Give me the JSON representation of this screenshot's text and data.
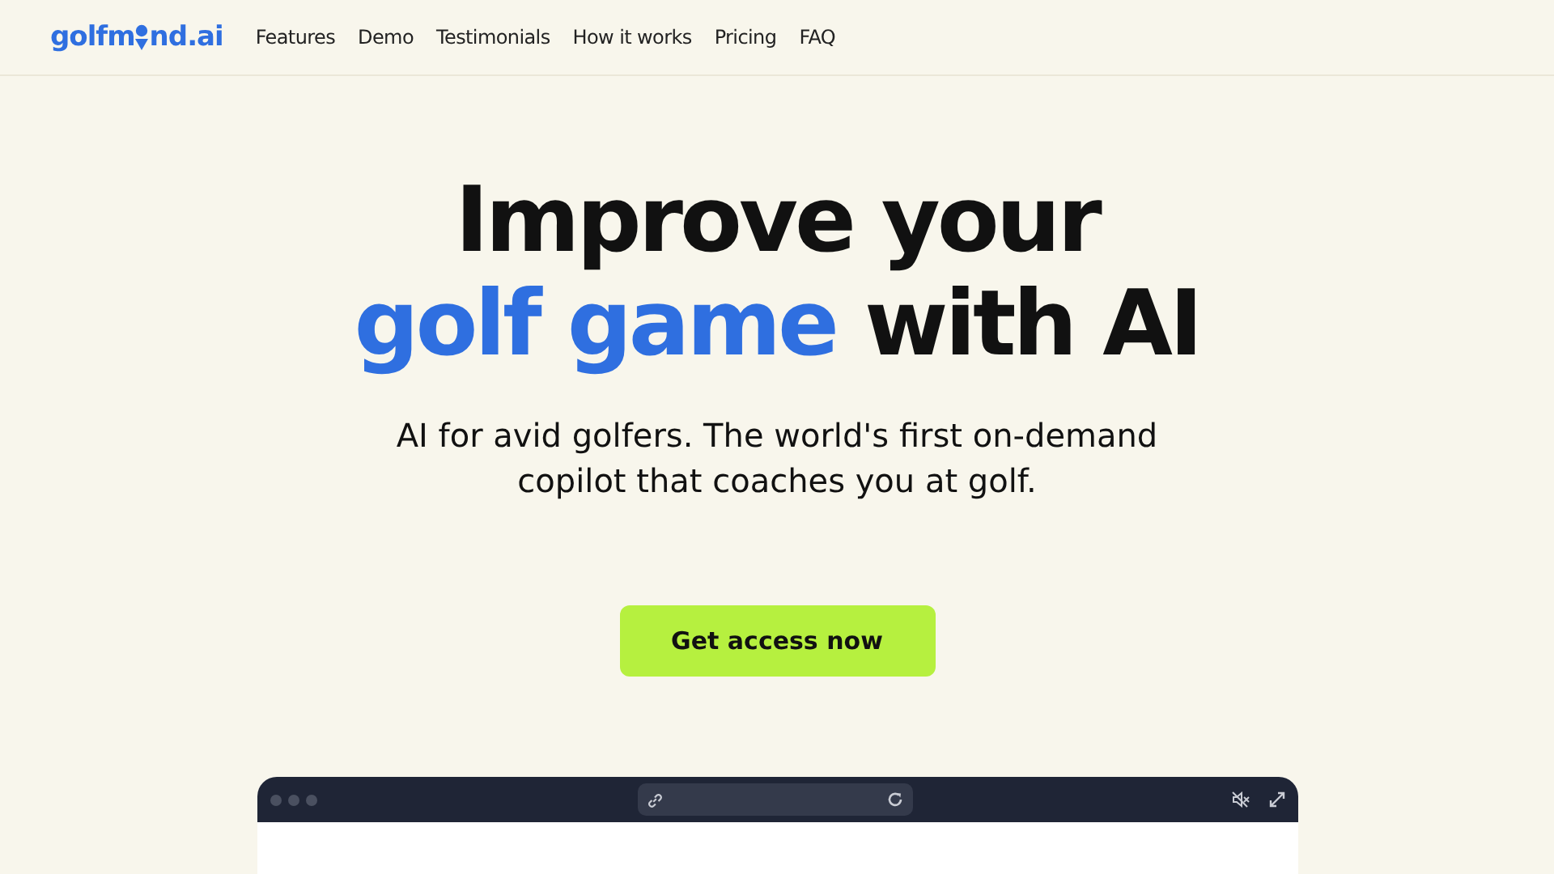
{
  "logo": {
    "before": "golfm",
    "after": "nd.ai"
  },
  "nav": [
    "Features",
    "Demo",
    "Testimonials",
    "How it works",
    "Pricing",
    "FAQ"
  ],
  "hero": {
    "line1": "Improve your",
    "highlight": "golf game",
    "rest": "with AI",
    "subtitle": "AI for avid golfers. The world's first on-demand copilot that coaches you at golf.",
    "cta": "Get access now"
  }
}
